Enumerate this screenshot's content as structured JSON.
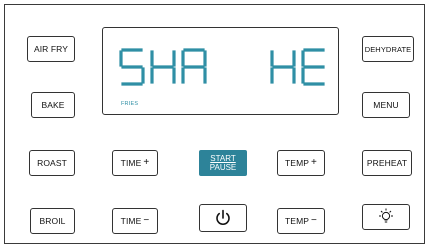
{
  "buttons": {
    "air_fry": "AIR FRY",
    "bake": "BAKE",
    "roast": "ROAST",
    "broil": "BROIL",
    "dehydrate": "DEHYDRATE",
    "menu": "MENU",
    "preheat": "PREHEAT",
    "time_plus": "TIME",
    "time_minus": "TIME",
    "temp_plus": "TEMP",
    "temp_minus": "TEMP",
    "start_line1": "START",
    "start_line2": "PAUSE",
    "plus_sign": "+",
    "minus_sign": "−"
  },
  "display": {
    "main_text": "SHA  HE",
    "mode_label": "FRIES",
    "segment_color": "#2f8fa5"
  },
  "icons": {
    "power": "power-icon",
    "light": "light-bulb-icon"
  },
  "colors": {
    "start_button": "#2d8399",
    "border": "#333333"
  }
}
